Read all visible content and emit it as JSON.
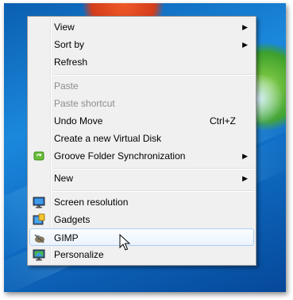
{
  "menu": {
    "items": [
      {
        "label": "View",
        "submenu": true,
        "enabled": true
      },
      {
        "label": "Sort by",
        "submenu": true,
        "enabled": true
      },
      {
        "label": "Refresh",
        "enabled": true
      },
      {
        "label": "Paste",
        "enabled": false
      },
      {
        "label": "Paste shortcut",
        "enabled": false
      },
      {
        "label": "Undo Move",
        "shortcut": "Ctrl+Z",
        "enabled": true
      },
      {
        "label": "Create a new Virtual Disk",
        "enabled": true
      },
      {
        "label": "Groove Folder Synchronization",
        "submenu": true,
        "enabled": true,
        "icon": "groove-sync-icon"
      },
      {
        "label": "New",
        "submenu": true,
        "enabled": true
      },
      {
        "label": "Screen resolution",
        "enabled": true,
        "icon": "monitor-icon"
      },
      {
        "label": "Gadgets",
        "enabled": true,
        "icon": "gadgets-icon"
      },
      {
        "label": "GIMP",
        "enabled": true,
        "icon": "gimp-icon",
        "highlighted": true
      },
      {
        "label": "Personalize",
        "enabled": true,
        "icon": "personalize-icon"
      }
    ],
    "submenu_arrow": "▶"
  },
  "colors": {
    "highlight_border": "#aecff7",
    "disabled_text": "#8d8d8d",
    "menu_bg": "#f0f0f0"
  }
}
